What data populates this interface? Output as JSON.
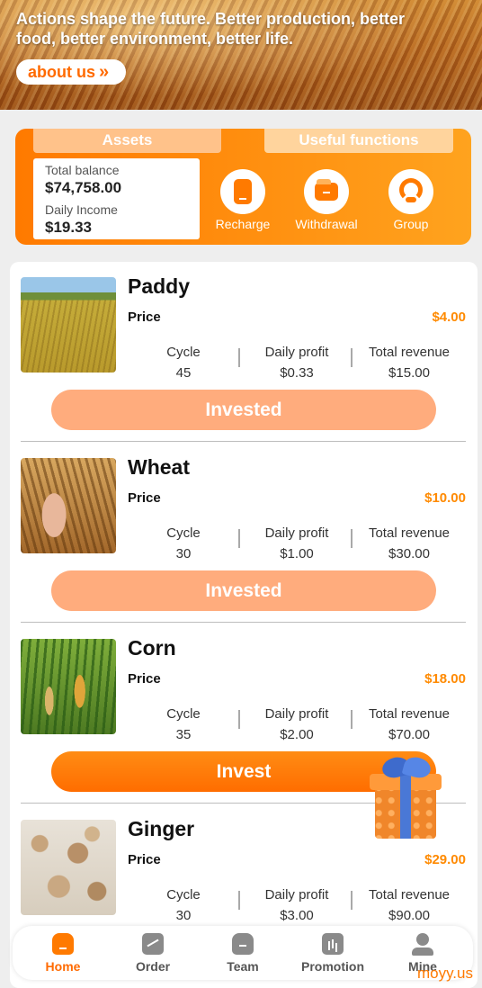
{
  "banner": {
    "text": "Actions shape the future. Better production, better food, better environment, better life.",
    "about_label": "about us",
    "about_chevron": "»"
  },
  "panel": {
    "tab_assets": "Assets",
    "tab_useful": "Useful functions",
    "total_balance_label": "Total balance",
    "total_balance_value": "$74,758.00",
    "daily_income_label": "Daily Income",
    "daily_income_value": "$19.33",
    "functions": [
      {
        "label": "Recharge",
        "icon": "recharge-icon"
      },
      {
        "label": "Withdrawal",
        "icon": "wallet-icon"
      },
      {
        "label": "Group",
        "icon": "headset-icon"
      }
    ]
  },
  "products": [
    {
      "name": "Paddy",
      "price_label": "Price",
      "price": "$4.00",
      "cycle_label": "Cycle",
      "cycle": "45",
      "daily_label": "Daily profit",
      "daily": "$0.33",
      "total_label": "Total revenue",
      "total": "$15.00",
      "action": "Invested",
      "invested": true
    },
    {
      "name": "Wheat",
      "price_label": "Price",
      "price": "$10.00",
      "cycle_label": "Cycle",
      "cycle": "30",
      "daily_label": "Daily profit",
      "daily": "$1.00",
      "total_label": "Total revenue",
      "total": "$30.00",
      "action": "Invested",
      "invested": true
    },
    {
      "name": "Corn",
      "price_label": "Price",
      "price": "$18.00",
      "cycle_label": "Cycle",
      "cycle": "35",
      "daily_label": "Daily profit",
      "daily": "$2.00",
      "total_label": "Total revenue",
      "total": "$70.00",
      "action": "Invest",
      "invested": false
    },
    {
      "name": "Ginger",
      "price_label": "Price",
      "price": "$29.00",
      "cycle_label": "Cycle",
      "cycle": "30",
      "daily_label": "Daily profit",
      "daily": "$3.00",
      "total_label": "Total revenue",
      "total": "$90.00"
    }
  ],
  "nav": [
    {
      "label": "Home",
      "icon": "home-icon",
      "active": true
    },
    {
      "label": "Order",
      "icon": "chart-icon"
    },
    {
      "label": "Team",
      "icon": "bag-icon"
    },
    {
      "label": "Promotion",
      "icon": "bar-chart-icon"
    },
    {
      "label": "Mine",
      "icon": "user-icon"
    }
  ],
  "watermark": "moyy.us",
  "colors": {
    "accent": "#ff7a00",
    "price": "#ff8a00",
    "invested_button": "#ffac7d"
  }
}
